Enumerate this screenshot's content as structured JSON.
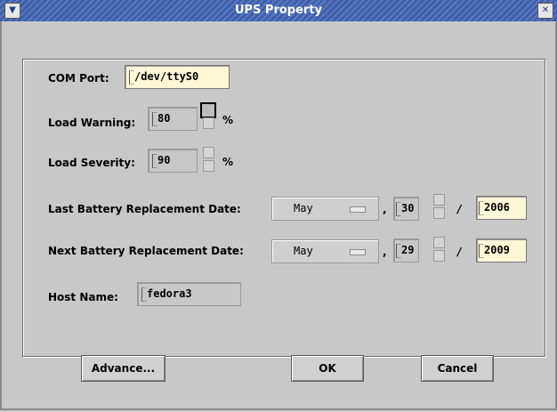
{
  "window": {
    "title": "UPS Property"
  },
  "form": {
    "com_port": {
      "label": "COM Port:",
      "value": "/dev/ttyS0"
    },
    "load_warning": {
      "label": "Load Warning:",
      "value": "80",
      "unit": "%"
    },
    "load_severity": {
      "label": "Load Severity:",
      "value": "90",
      "unit": "%"
    },
    "last_battery": {
      "label": "Last Battery Replacement Date:",
      "month": "May",
      "day": "30",
      "year": "2006",
      "comma": ",",
      "slash": "/"
    },
    "next_battery": {
      "label": "Next Battery Replacement Date:",
      "month": "May",
      "day": "29",
      "year": "2009",
      "comma": ",",
      "slash": "/"
    },
    "host_name": {
      "label": "Host Name:",
      "value": "fedora3"
    }
  },
  "buttons": {
    "advance": "Advance...",
    "ok": "OK",
    "cancel": "Cancel"
  },
  "icons": {
    "window_menu": "chevron-down-icon",
    "window_close": "close-icon"
  },
  "colors": {
    "titlebar": "#3f5fa9",
    "edit_field_bg": "#fff7d6",
    "dialog_bg": "#c8c8c8"
  }
}
